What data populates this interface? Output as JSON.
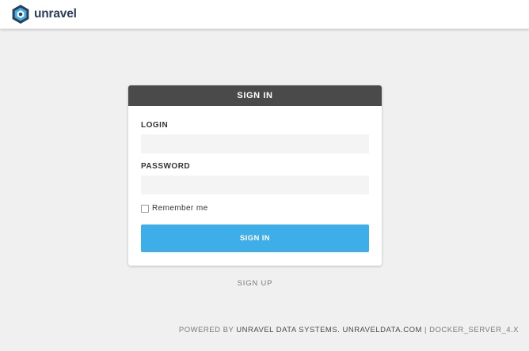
{
  "brand": {
    "name": "unravel",
    "logo_icon": "unravel-hexagon-logo"
  },
  "login_card": {
    "title": "SIGN IN",
    "login_label": "LOGIN",
    "login_value": "",
    "password_label": "PASSWORD",
    "password_value": "",
    "remember_label": "Remember me",
    "remember_checked": false,
    "submit_label": "SIGN IN"
  },
  "signup_label": "SIGN UP",
  "footer": {
    "powered_by": "POWERED BY",
    "company": "UNRAVEL DATA SYSTEMS.",
    "website": "UNRAVELDATA.COM",
    "separator": "|",
    "server": "DOCKER_SERVER_4.X"
  },
  "colors": {
    "header_bg": "#4a4a4a",
    "button_bg": "#3eaee9",
    "page_bg": "#f0f0f0",
    "brand_text": "#2b3e5a"
  }
}
